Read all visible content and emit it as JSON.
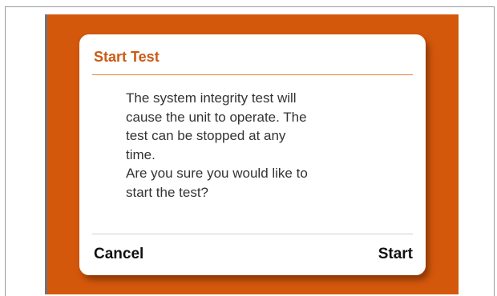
{
  "dialog": {
    "title": "Start Test",
    "message": "The system integrity test will\ncause the unit to operate.  The\ntest can be stopped at any\ntime.\nAre you sure you would like to\nstart the test?",
    "cancel_label": "Cancel",
    "start_label": "Start"
  },
  "colors": {
    "background": "#d4580c",
    "title_accent": "#cc5a12"
  }
}
